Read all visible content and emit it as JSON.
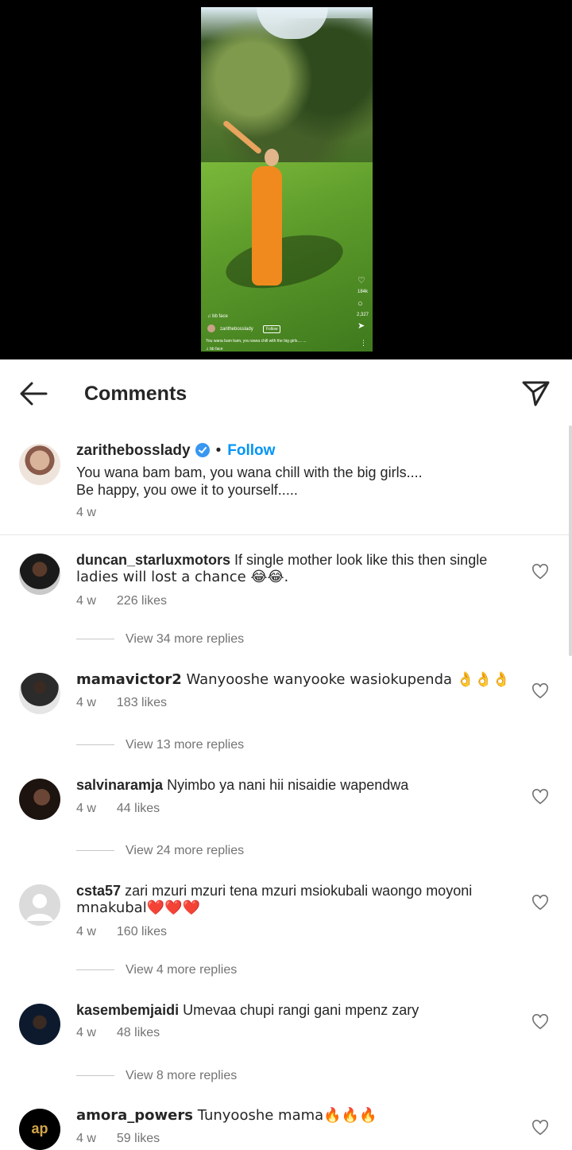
{
  "video": {
    "audio_top": "♫ bb face",
    "username": "zarithebosslady",
    "follow": "Follow",
    "caption": "You wana bam bam, you wana chill with the big girls.... ...",
    "audio_bottom": "♫ bb face",
    "like_count": "184k",
    "comment_count": "2,327"
  },
  "header": {
    "title": "Comments"
  },
  "caption": {
    "username": "zarithebosslady",
    "dot": "•",
    "follow": "Follow",
    "line1": "You wana bam bam, you wana chill with the big girls....",
    "line2": "Be happy, you owe it to yourself.....",
    "time": "4 w"
  },
  "comments": [
    {
      "username": "duncan_starluxmotors",
      "text_line1": " If single mother look like this then single",
      "text_line2": "ladies will lost a chance 😂😂.",
      "time": "4 w",
      "likes": "226 likes",
      "replies": "View 34 more replies"
    },
    {
      "username": "mamavictor2",
      "text_line1": " Wanyooshe wanyooke wasiokupenda 👌👌👌",
      "text_line2": "",
      "time": "4 w",
      "likes": "183 likes",
      "replies": "View 13 more replies"
    },
    {
      "username": "salvinaramja",
      "text_line1": " Nyimbo ya nani hii nisaidie wapendwa",
      "text_line2": "",
      "time": "4 w",
      "likes": "44 likes",
      "replies": "View 24 more replies"
    },
    {
      "username": "csta57",
      "text_line1": " zari mzuri mzuri tena mzuri msiokubali waongo moyoni",
      "text_line2": "mnakubal❤️❤️❤️",
      "time": "4 w",
      "likes": "160 likes",
      "replies": "View 4 more replies"
    },
    {
      "username": "kasembemjaidi",
      "text_line1": " Umevaa chupi rangi gani mpenz zary",
      "text_line2": "",
      "time": "4 w",
      "likes": "48 likes",
      "replies": "View 8 more replies"
    },
    {
      "username": "amora_powers",
      "text_line1": " Tunyooshe mama🔥🔥🔥",
      "text_line2": "",
      "time": "4 w",
      "likes": "59 likes",
      "replies": ""
    }
  ],
  "colors": {
    "link": "#0095f6",
    "meta": "#737373",
    "text": "#262626"
  }
}
